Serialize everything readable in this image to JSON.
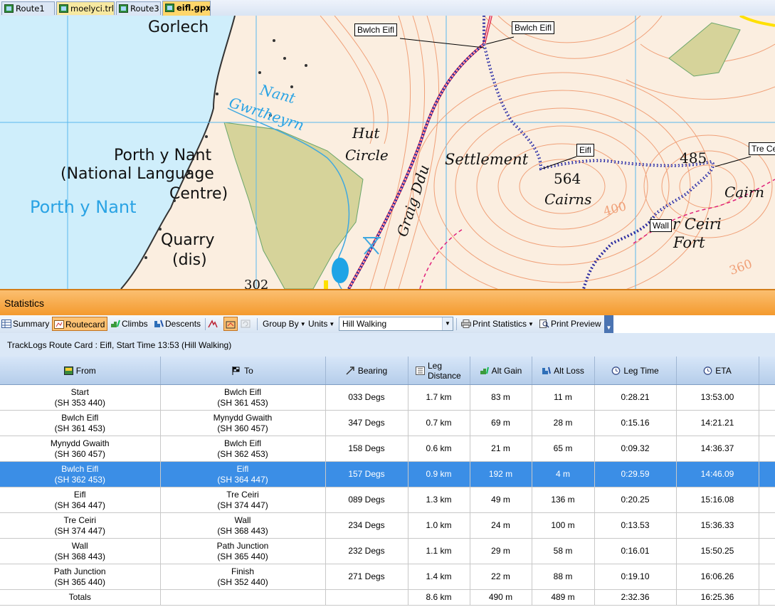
{
  "tabs": [
    {
      "label": "Route1"
    },
    {
      "label": "moelyci.trl"
    },
    {
      "label": "Route3"
    },
    {
      "label": "eifl.gpx",
      "active": true
    }
  ],
  "map": {
    "place_labels": {
      "gorlech": "Gorlech",
      "nant": "Nant",
      "gwrtheyrn": "Gwrtheyrn",
      "porth_y_nant": "Porth y Nant",
      "national_language": "(National Language",
      "centre": "Centre)",
      "porth_y_nant_blue": "Porth y Nant",
      "quarry": "Quarry",
      "dis": "(dis)",
      "hut": "Hut",
      "circle": "Circle",
      "settlement": "Settlement",
      "graig_ddu": "Graig Ddu",
      "cairns": "Cairns",
      "spot_564": "564",
      "spot_485": "485",
      "cairn": "Cairn",
      "tre_ceiri": "r Ceiri",
      "fort": "Fort",
      "contour_400": "400",
      "contour_302": "302",
      "contour_360": "360"
    },
    "waypoints": [
      "Bwlch Eifl",
      "Bwlch Eifl",
      "Eifl",
      "Tre Ce",
      "Wall"
    ],
    "colors": {
      "sea": "#cfeefb",
      "grid": "#5ab8ee",
      "contour": "#f0a078",
      "wood": "#d6d39a",
      "route": "#e03050",
      "track": "#2a2aa0"
    }
  },
  "statistics": {
    "title": "Statistics",
    "toolbar": {
      "summary": "Summary",
      "routecard": "Routecard",
      "climbs": "Climbs",
      "descents": "Descents",
      "group_by": "Group By",
      "units": "Units",
      "activity": "Hill Walking",
      "print_statistics": "Print Statistics",
      "print_preview": "Print Preview"
    },
    "caption": "TrackLogs Route Card : Eifl, Start Time 13:53 (Hill Walking)",
    "columns": [
      "From",
      "To",
      "Bearing",
      "Leg Distance",
      "Alt Gain",
      "Alt Loss",
      "Leg Time",
      "ETA"
    ],
    "rows": [
      {
        "from": "Start",
        "from_ref": "(SH 353 440)",
        "to": "Bwlch Eifl",
        "to_ref": "(SH 361 453)",
        "bearing": "033 Degs",
        "dist": "1.7 km",
        "gain": "83 m",
        "loss": "11 m",
        "time": "0:28.21",
        "eta": "13:53.00"
      },
      {
        "from": "Bwlch Eifl",
        "from_ref": "(SH 361 453)",
        "to": "Mynydd Gwaith",
        "to_ref": "(SH 360 457)",
        "bearing": "347 Degs",
        "dist": "0.7 km",
        "gain": "69 m",
        "loss": "28 m",
        "time": "0:15.16",
        "eta": "14:21.21"
      },
      {
        "from": "Mynydd Gwaith",
        "from_ref": "(SH 360 457)",
        "to": "Bwlch Eifl",
        "to_ref": "(SH 362 453)",
        "bearing": "158 Degs",
        "dist": "0.6 km",
        "gain": "21 m",
        "loss": "65 m",
        "time": "0:09.32",
        "eta": "14:36.37"
      },
      {
        "from": "Bwlch Eifl",
        "from_ref": "(SH 362 453)",
        "to": "Eifl",
        "to_ref": "(SH 364 447)",
        "bearing": "157 Degs",
        "dist": "0.9 km",
        "gain": "192 m",
        "loss": "4 m",
        "time": "0:29.59",
        "eta": "14:46.09",
        "selected": true
      },
      {
        "from": "Eifl",
        "from_ref": "(SH 364 447)",
        "to": "Tre Ceiri",
        "to_ref": "(SH 374 447)",
        "bearing": "089 Degs",
        "dist": "1.3 km",
        "gain": "49 m",
        "loss": "136 m",
        "time": "0:20.25",
        "eta": "15:16.08"
      },
      {
        "from": "Tre Ceiri",
        "from_ref": "(SH 374 447)",
        "to": "Wall",
        "to_ref": "(SH 368 443)",
        "bearing": "234 Degs",
        "dist": "1.0 km",
        "gain": "24 m",
        "loss": "100 m",
        "time": "0:13.53",
        "eta": "15:36.33"
      },
      {
        "from": "Wall",
        "from_ref": "(SH 368 443)",
        "to": "Path Junction",
        "to_ref": "(SH 365 440)",
        "bearing": "232 Degs",
        "dist": "1.1 km",
        "gain": "29 m",
        "loss": "58 m",
        "time": "0:16.01",
        "eta": "15:50.25"
      },
      {
        "from": "Path Junction",
        "from_ref": "(SH 365 440)",
        "to": "Finish",
        "to_ref": "(SH 352 440)",
        "bearing": "271 Degs",
        "dist": "1.4 km",
        "gain": "22 m",
        "loss": "88 m",
        "time": "0:19.10",
        "eta": "16:06.26"
      }
    ],
    "totals": {
      "label": "Totals",
      "dist": "8.6 km",
      "gain": "490 m",
      "loss": "489 m",
      "time": "2:32.36",
      "eta": "16:25.36"
    }
  }
}
